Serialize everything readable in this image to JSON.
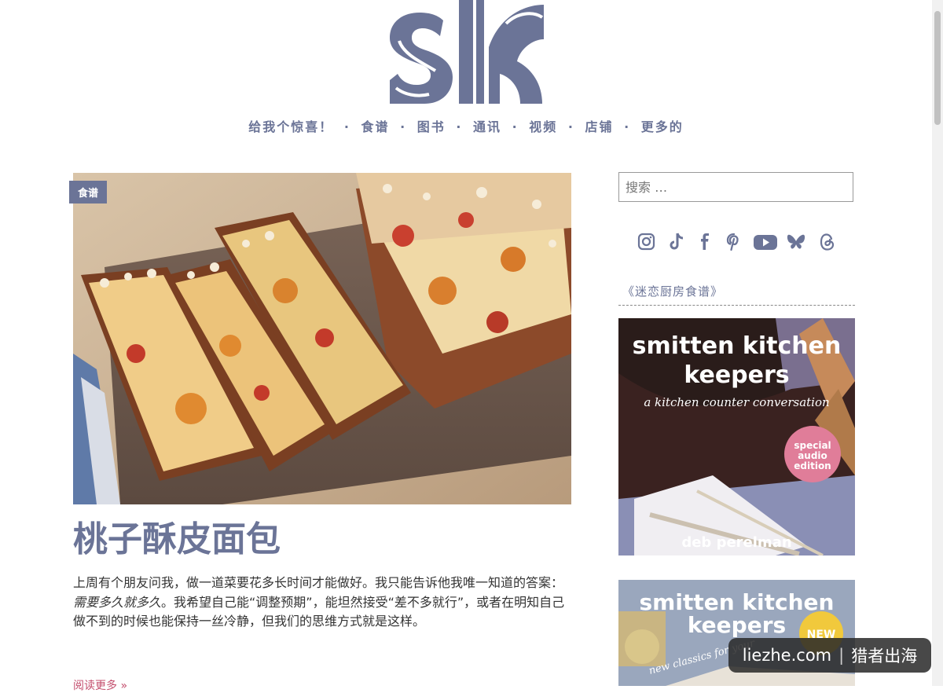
{
  "site": {
    "logo_text": "sk"
  },
  "nav": {
    "items": [
      {
        "label": "给我个惊喜！"
      },
      {
        "label": "食谱"
      },
      {
        "label": "图书"
      },
      {
        "label": "通讯"
      },
      {
        "label": "视频"
      },
      {
        "label": "店铺"
      },
      {
        "label": "更多的"
      }
    ]
  },
  "post": {
    "category": "食谱",
    "title": "桃子酥皮面包",
    "excerpt_1": "上周有个朋友问我，做一道菜要花多长时间才能做好。我只能告诉他我唯一知道的答案：",
    "excerpt_em": "需要多久就多久",
    "excerpt_2": "。我希望自己能“调整预期”，能坦然接受“差不多就行”，或者在明知自己做不到的时候也能保持一丝冷静，但我们的思维方式就是这样。",
    "read_more": "阅读更多 »"
  },
  "sidebar": {
    "search": {
      "placeholder": "搜索 …",
      "value": ""
    },
    "social_icons": [
      "instagram-icon",
      "tiktok-icon",
      "facebook-icon",
      "pinterest-icon",
      "youtube-icon",
      "bluesky-icon",
      "threads-icon"
    ],
    "widget_title": "《迷恋厨房食谱》",
    "book1": {
      "line1": "smitten kitchen",
      "line2": "keepers",
      "subtitle": "a kitchen counter conversation",
      "badge": [
        "special",
        "audio",
        "edition"
      ],
      "author": "deb perelman"
    },
    "book2": {
      "line1": "smitten kitchen",
      "line2": "keepers",
      "badge": "NEW",
      "subtitle": "new classics for your"
    }
  },
  "watermark": {
    "left": "liezhe.com",
    "right": "猎者出海"
  },
  "colors": {
    "accent": "#6b7497",
    "link": "#c44f6e"
  }
}
